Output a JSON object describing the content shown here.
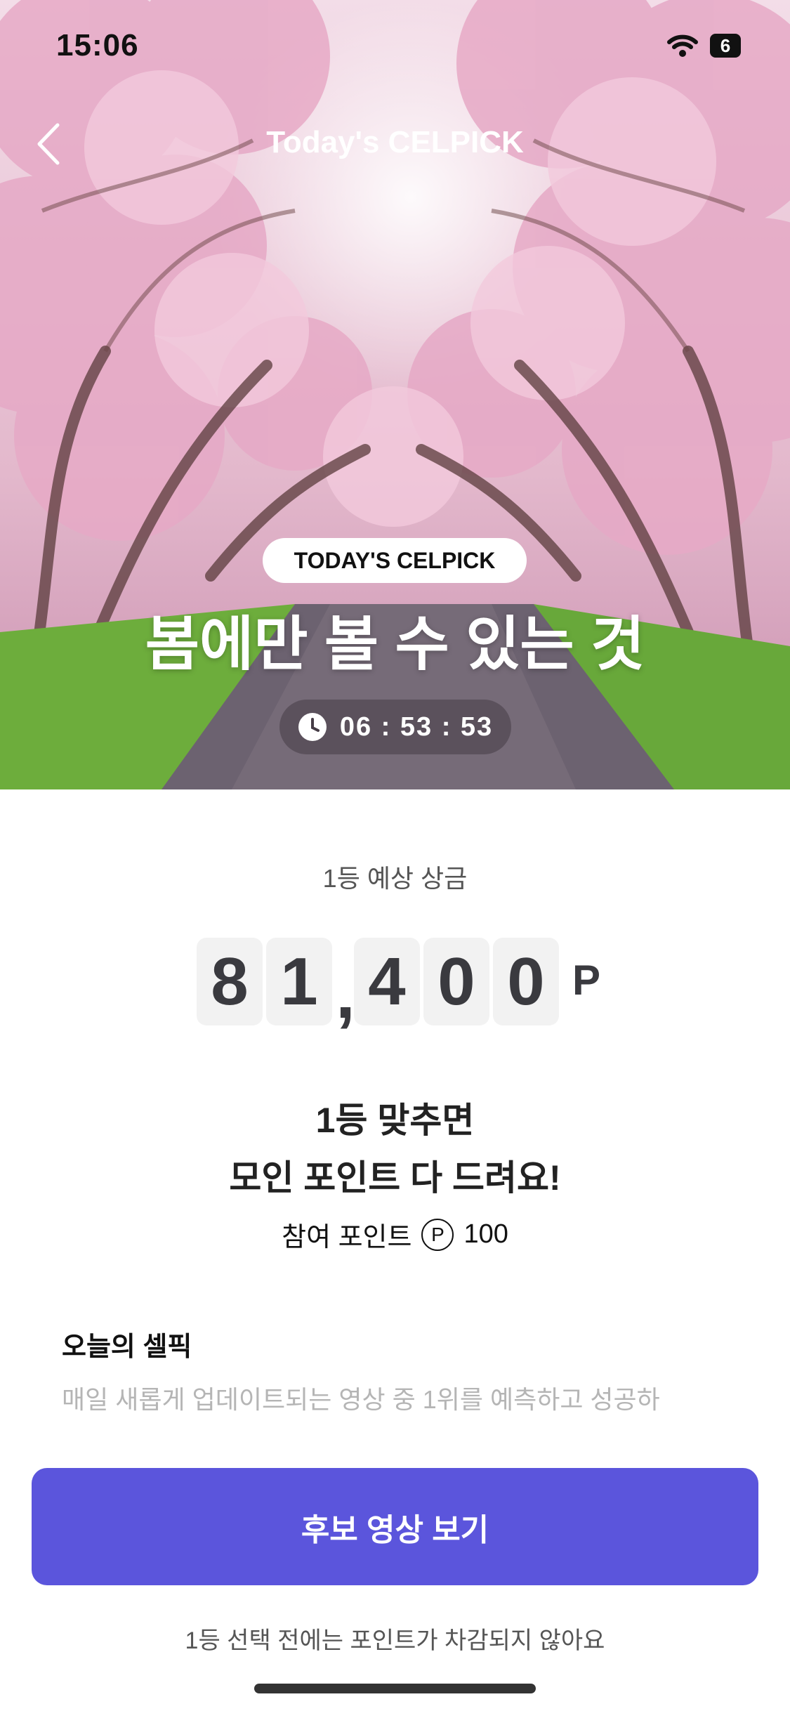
{
  "status_bar": {
    "time": "15:06",
    "battery": "6"
  },
  "nav": {
    "title": "Today's CELPICK"
  },
  "hero": {
    "badge": "TODAY'S CELPICK",
    "title": "봄에만 볼 수 있는 것",
    "timer": "06 : 53 : 53"
  },
  "prize": {
    "label": "1등 예상 상금",
    "digits": [
      "8",
      "1",
      "4",
      "0",
      "0"
    ],
    "comma": ",",
    "unit": "P"
  },
  "headline": {
    "line1": "1등 맞추면",
    "line2": "모인 포인트 다 드려요!"
  },
  "entry": {
    "label": "참여 포인트",
    "icon": "P",
    "amount": "100"
  },
  "section": {
    "title": "오늘의 셀픽",
    "description": "매일 새롭게 업데이트되는 영상 중 1위를 예측하고 성공하"
  },
  "cta": {
    "label": "후보 영상 보기"
  },
  "notice": "1등 선택 전에는 포인트가 차감되지 않아요",
  "colors": {
    "accent": "#5b55dc",
    "blossom": "#e9bfd4"
  }
}
